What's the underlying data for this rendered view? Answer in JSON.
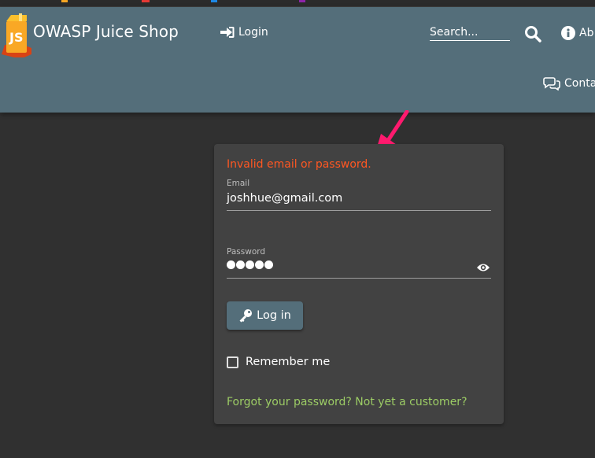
{
  "browser": {
    "strip_colors": [
      "#f5a623",
      "#e53935",
      "#1e88e5",
      "#8e24aa"
    ]
  },
  "navbar": {
    "app_title": "OWASP Juice Shop",
    "logo_icon": "juice-box-logo",
    "login_label": "Login",
    "login_icon": "sign-in-icon",
    "search_placeholder": "Search...",
    "search_icon": "search-icon",
    "about_label": "Ab",
    "about_icon": "info-icon",
    "contact_label": "Conta",
    "contact_icon": "chat-icon",
    "background_color": "#546e7a"
  },
  "login_form": {
    "error_message": "Invalid email or password.",
    "email_label": "Email",
    "email_value": "joshhue@gmail.com",
    "password_label": "Password",
    "password_dot_count": 5,
    "show_password_icon": "eye-icon",
    "login_button_label": "Log in",
    "login_button_icon": "key-icon",
    "remember_label": "Remember me",
    "remember_checked": false,
    "forgot_link": "Forgot your password? Not yet a customer?",
    "error_color": "#ff5722",
    "link_color": "#9ccc65"
  },
  "annotation": {
    "arrow_color": "#ff1a6e"
  }
}
